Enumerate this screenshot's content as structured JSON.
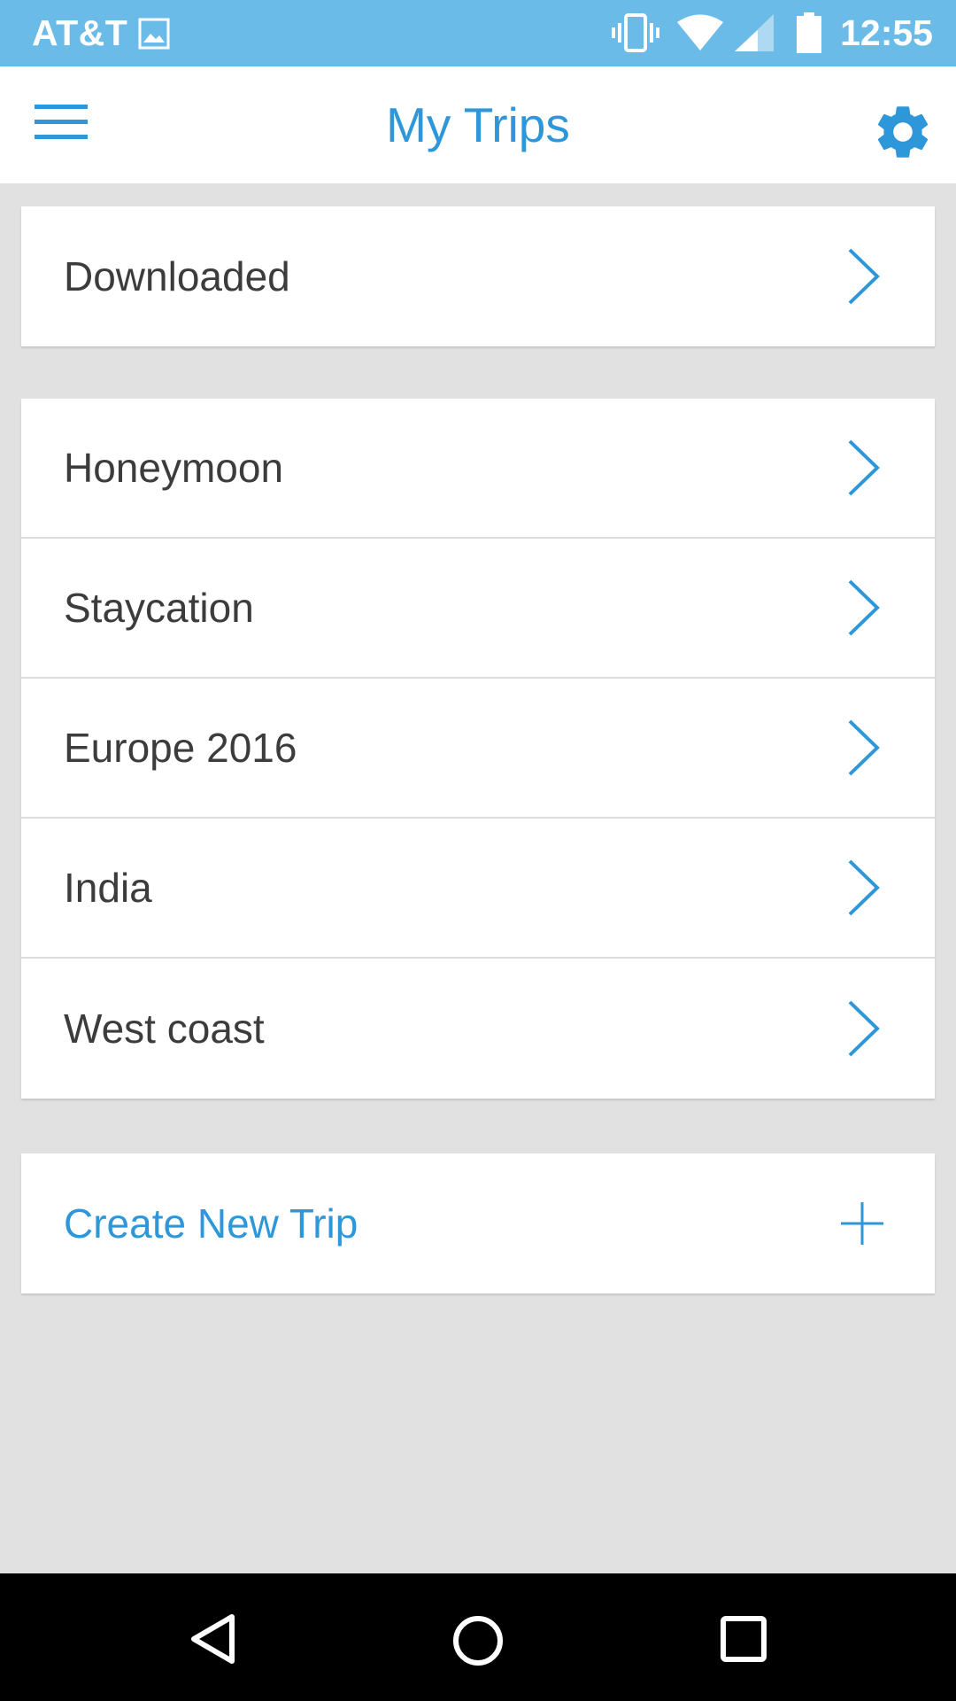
{
  "status_bar": {
    "carrier": "AT&T",
    "time": "12:55",
    "icons": [
      "gallery-notification-icon",
      "vibrate-icon",
      "wifi-icon",
      "cell-signal-icon",
      "battery-icon"
    ]
  },
  "header": {
    "title": "My Trips",
    "menu_icon": "hamburger-menu-icon",
    "settings_icon": "gear-icon"
  },
  "downloaded": {
    "label": "Downloaded"
  },
  "trips": [
    {
      "label": "Honeymoon"
    },
    {
      "label": "Staycation"
    },
    {
      "label": "Europe 2016"
    },
    {
      "label": "India"
    },
    {
      "label": "West coast"
    }
  ],
  "create": {
    "label": "Create New Trip",
    "icon": "plus-icon"
  },
  "nav_bar": {
    "icons": [
      "back-icon",
      "home-icon",
      "recents-icon"
    ]
  },
  "colors": {
    "accent": "#2d97d9",
    "status_bar": "#6bbbe9",
    "background": "#e1e1e1",
    "text": "#3c3c3c"
  }
}
